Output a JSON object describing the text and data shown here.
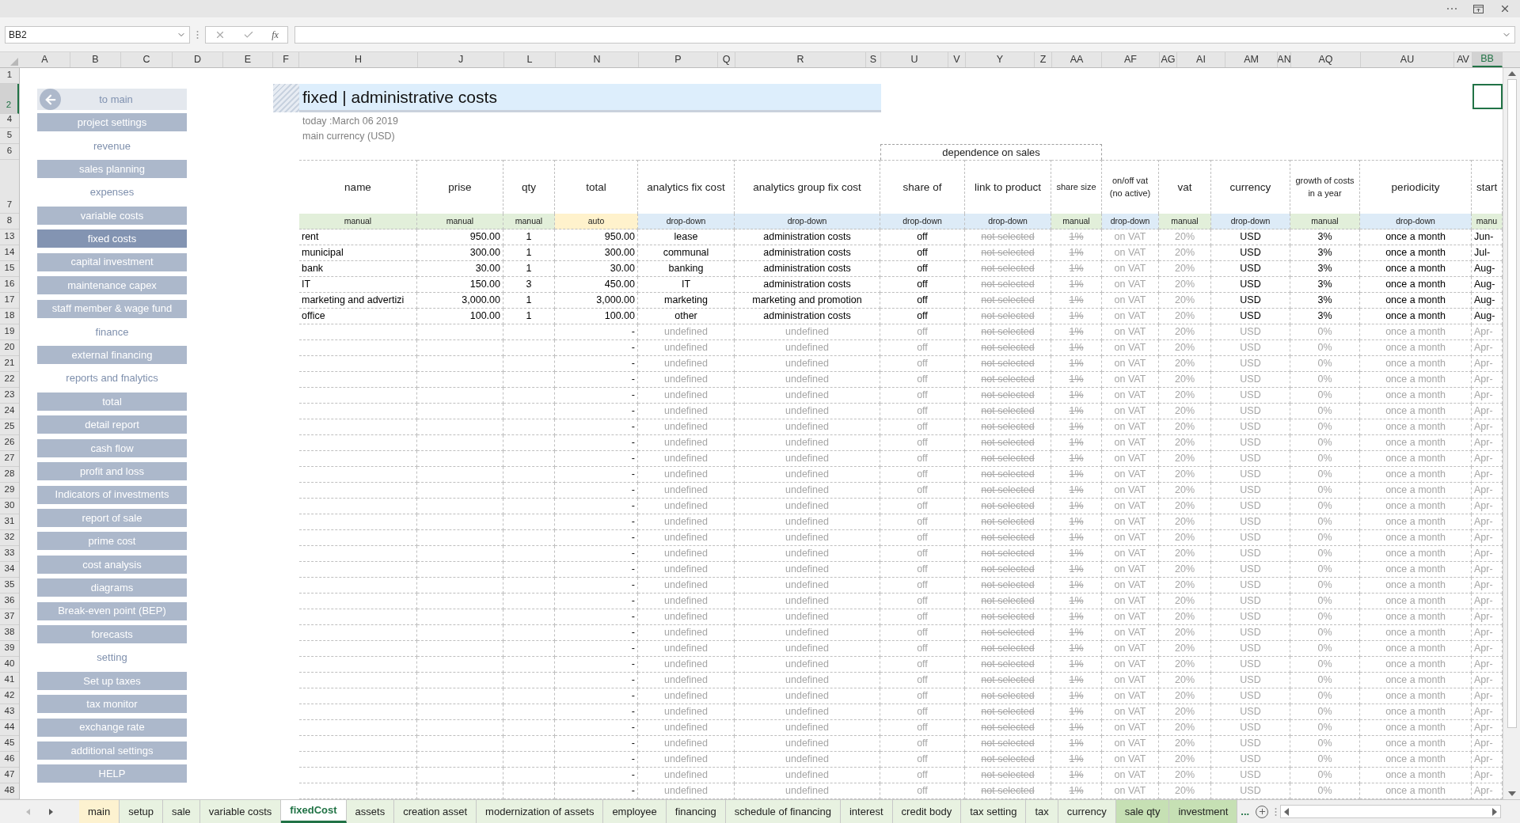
{
  "name_box": {
    "value": "BB2"
  },
  "formula_bar": {
    "function_label": "fx"
  },
  "column_headers": [
    {
      "label": "A",
      "selected": false
    },
    {
      "label": "B",
      "selected": false
    },
    {
      "label": "C",
      "selected": false
    },
    {
      "label": "D",
      "selected": false
    },
    {
      "label": "E",
      "selected": false
    },
    {
      "label": "F",
      "selected": false
    },
    {
      "label": "H",
      "selected": false
    },
    {
      "label": "J",
      "selected": false
    },
    {
      "label": "L",
      "selected": false
    },
    {
      "label": "N",
      "selected": false
    },
    {
      "label": "P",
      "selected": false
    },
    {
      "label": "Q",
      "selected": false
    },
    {
      "label": "R",
      "selected": false
    },
    {
      "label": "S",
      "selected": false
    },
    {
      "label": "U",
      "selected": false
    },
    {
      "label": "V",
      "selected": false
    },
    {
      "label": "Y",
      "selected": false
    },
    {
      "label": "Z",
      "selected": false
    },
    {
      "label": "AA",
      "selected": false
    },
    {
      "label": "AF",
      "selected": false
    },
    {
      "label": "AG",
      "selected": false
    },
    {
      "label": "AI",
      "selected": false
    },
    {
      "label": "AM",
      "selected": false
    },
    {
      "label": "AN",
      "selected": false
    },
    {
      "label": "AQ",
      "selected": false
    },
    {
      "label": "AU",
      "selected": false
    },
    {
      "label": "AV",
      "selected": false
    },
    {
      "label": "BB",
      "selected": true
    }
  ],
  "row_numbers": [
    {
      "label": "1",
      "selected": false
    },
    {
      "label": "2",
      "selected": true
    },
    {
      "label": "4",
      "selected": false
    },
    {
      "label": "5",
      "selected": false
    },
    {
      "label": "6",
      "selected": false
    },
    {
      "label": "7",
      "selected": false
    },
    {
      "label": "8",
      "selected": false
    },
    {
      "label": "13",
      "selected": false
    },
    {
      "label": "14",
      "selected": false
    },
    {
      "label": "15",
      "selected": false
    },
    {
      "label": "16",
      "selected": false
    },
    {
      "label": "17",
      "selected": false
    },
    {
      "label": "18",
      "selected": false
    },
    {
      "label": "19",
      "selected": false
    },
    {
      "label": "20",
      "selected": false
    },
    {
      "label": "21",
      "selected": false
    },
    {
      "label": "22",
      "selected": false
    },
    {
      "label": "23",
      "selected": false
    },
    {
      "label": "24",
      "selected": false
    },
    {
      "label": "25",
      "selected": false
    },
    {
      "label": "26",
      "selected": false
    },
    {
      "label": "27",
      "selected": false
    },
    {
      "label": "28",
      "selected": false
    },
    {
      "label": "29",
      "selected": false
    },
    {
      "label": "30",
      "selected": false
    },
    {
      "label": "31",
      "selected": false
    },
    {
      "label": "32",
      "selected": false
    },
    {
      "label": "33",
      "selected": false
    },
    {
      "label": "34",
      "selected": false
    },
    {
      "label": "35",
      "selected": false
    },
    {
      "label": "36",
      "selected": false
    },
    {
      "label": "37",
      "selected": false
    },
    {
      "label": "38",
      "selected": false
    },
    {
      "label": "39",
      "selected": false
    },
    {
      "label": "40",
      "selected": false
    },
    {
      "label": "41",
      "selected": false
    },
    {
      "label": "42",
      "selected": false
    },
    {
      "label": "43",
      "selected": false
    },
    {
      "label": "44",
      "selected": false
    },
    {
      "label": "45",
      "selected": false
    },
    {
      "label": "46",
      "selected": false
    },
    {
      "label": "47",
      "selected": false
    },
    {
      "label": "48",
      "selected": false
    }
  ],
  "sidebar": [
    {
      "kind": "back",
      "label": "to main"
    },
    {
      "kind": "button",
      "label": "project settings",
      "selected": false
    },
    {
      "kind": "section",
      "label": "revenue"
    },
    {
      "kind": "button",
      "label": "sales planning",
      "selected": false
    },
    {
      "kind": "section",
      "label": "expenses"
    },
    {
      "kind": "button",
      "label": "variable costs",
      "selected": false
    },
    {
      "kind": "button",
      "label": "fixed costs",
      "selected": true
    },
    {
      "kind": "button",
      "label": "capital investment",
      "selected": false
    },
    {
      "kind": "button",
      "label": "maintenance capex",
      "selected": false
    },
    {
      "kind": "button",
      "label": "staff member & wage fund",
      "selected": false
    },
    {
      "kind": "section",
      "label": "finance"
    },
    {
      "kind": "button",
      "label": "external financing",
      "selected": false
    },
    {
      "kind": "section",
      "label": "reports and fnalytics"
    },
    {
      "kind": "button",
      "label": "total",
      "selected": false
    },
    {
      "kind": "button",
      "label": "detail report",
      "selected": false
    },
    {
      "kind": "button",
      "label": "cash flow",
      "selected": false
    },
    {
      "kind": "button",
      "label": "profit and loss",
      "selected": false
    },
    {
      "kind": "button",
      "label": "Indicators of investments",
      "selected": false
    },
    {
      "kind": "button",
      "label": "report of sale",
      "selected": false
    },
    {
      "kind": "button",
      "label": "prime cost",
      "selected": false
    },
    {
      "kind": "button",
      "label": "cost analysis",
      "selected": false
    },
    {
      "kind": "button",
      "label": "diagrams",
      "selected": false
    },
    {
      "kind": "button",
      "label": "Break-even point (BEP)",
      "selected": false
    },
    {
      "kind": "button",
      "label": "forecasts",
      "selected": false
    },
    {
      "kind": "section",
      "label": "setting"
    },
    {
      "kind": "button",
      "label": "Set up taxes",
      "selected": false
    },
    {
      "kind": "button",
      "label": "tax monitor",
      "selected": false
    },
    {
      "kind": "button",
      "label": "exchange rate",
      "selected": false
    },
    {
      "kind": "button",
      "label": "additional settings",
      "selected": false
    },
    {
      "kind": "button",
      "label": "HELP",
      "selected": false
    }
  ],
  "sheet": {
    "title": "fixed | administrative costs",
    "today": "today :March 06 2019",
    "currency": "main currency (USD)",
    "group_header": "dependence on sales",
    "columns": [
      {
        "label": "name",
        "input": "manual"
      },
      {
        "label": "prise",
        "input": "manual"
      },
      {
        "label": "qty",
        "input": "manual"
      },
      {
        "label": "total",
        "input": "auto"
      },
      {
        "label": "analytics fix cost",
        "input": "drop-down"
      },
      {
        "label": "analytics group fix cost",
        "input": "drop-down"
      },
      {
        "label": "share of",
        "input": "drop-down"
      },
      {
        "label": "link to product",
        "input": "drop-down"
      },
      {
        "label": "share size",
        "input": "manual"
      },
      {
        "label": "on/off vat (no active)",
        "input": "drop-down"
      },
      {
        "label": "vat",
        "input": "manual"
      },
      {
        "label": "currency",
        "input": "drop-down"
      },
      {
        "label": "growth of costs in a year",
        "input": "manual"
      },
      {
        "label": "periodicity",
        "input": "drop-down"
      },
      {
        "label": "start",
        "input": "manu"
      }
    ],
    "rows": [
      {
        "defined": true,
        "cells": [
          "rent",
          "950.00",
          "1",
          "950.00",
          "lease",
          "administration costs",
          "off",
          "not selected",
          "1%",
          "on VAT",
          "20%",
          "USD",
          "3%",
          "once a month",
          "Jun-"
        ]
      },
      {
        "defined": true,
        "cells": [
          "municipal",
          "300.00",
          "1",
          "300.00",
          "communal",
          "administration costs",
          "off",
          "not selected",
          "1%",
          "on VAT",
          "20%",
          "USD",
          "3%",
          "once a month",
          "Jul-"
        ]
      },
      {
        "defined": true,
        "cells": [
          "bank",
          "30.00",
          "1",
          "30.00",
          "banking",
          "administration costs",
          "off",
          "not selected",
          "1%",
          "on VAT",
          "20%",
          "USD",
          "3%",
          "once a month",
          "Aug-"
        ]
      },
      {
        "defined": true,
        "cells": [
          "IT",
          "150.00",
          "3",
          "450.00",
          "IT",
          "administration costs",
          "off",
          "not selected",
          "1%",
          "on VAT",
          "20%",
          "USD",
          "3%",
          "once a month",
          "Aug-"
        ]
      },
      {
        "defined": true,
        "cells": [
          "marketing and advertizi",
          "3,000.00",
          "1",
          "3,000.00",
          "marketing",
          "marketing and promotion",
          "off",
          "not selected",
          "1%",
          "on VAT",
          "20%",
          "USD",
          "3%",
          "once a month",
          "Aug-"
        ]
      },
      {
        "defined": true,
        "cells": [
          "office",
          "100.00",
          "1",
          "100.00",
          "other",
          "administration costs",
          "off",
          "not selected",
          "1%",
          "on VAT",
          "20%",
          "USD",
          "3%",
          "once a month",
          "Aug-"
        ]
      },
      {
        "defined": false,
        "cells": [
          "-",
          "undefined",
          "undefined",
          "off",
          "not selected",
          "1%",
          "on VAT",
          "20%",
          "USD",
          "0%",
          "once a month",
          "Apr-"
        ]
      },
      {
        "defined": false,
        "cells": [
          "-",
          "undefined",
          "undefined",
          "off",
          "not selected",
          "1%",
          "on VAT",
          "20%",
          "USD",
          "0%",
          "once a month",
          "Apr-"
        ]
      },
      {
        "defined": false,
        "cells": [
          "-",
          "undefined",
          "undefined",
          "off",
          "not selected",
          "1%",
          "on VAT",
          "20%",
          "USD",
          "0%",
          "once a month",
          "Apr-"
        ]
      },
      {
        "defined": false,
        "cells": [
          "-",
          "undefined",
          "undefined",
          "off",
          "not selected",
          "1%",
          "on VAT",
          "20%",
          "USD",
          "0%",
          "once a month",
          "Apr-"
        ]
      },
      {
        "defined": false,
        "cells": [
          "-",
          "undefined",
          "undefined",
          "off",
          "not selected",
          "1%",
          "on VAT",
          "20%",
          "USD",
          "0%",
          "once a month",
          "Apr-"
        ]
      },
      {
        "defined": false,
        "cells": [
          "-",
          "undefined",
          "undefined",
          "off",
          "not selected",
          "1%",
          "on VAT",
          "20%",
          "USD",
          "0%",
          "once a month",
          "Apr-"
        ]
      },
      {
        "defined": false,
        "cells": [
          "-",
          "undefined",
          "undefined",
          "off",
          "not selected",
          "1%",
          "on VAT",
          "20%",
          "USD",
          "0%",
          "once a month",
          "Apr-"
        ]
      },
      {
        "defined": false,
        "cells": [
          "-",
          "undefined",
          "undefined",
          "off",
          "not selected",
          "1%",
          "on VAT",
          "20%",
          "USD",
          "0%",
          "once a month",
          "Apr-"
        ]
      },
      {
        "defined": false,
        "cells": [
          "-",
          "undefined",
          "undefined",
          "off",
          "not selected",
          "1%",
          "on VAT",
          "20%",
          "USD",
          "0%",
          "once a month",
          "Apr-"
        ]
      },
      {
        "defined": false,
        "cells": [
          "-",
          "undefined",
          "undefined",
          "off",
          "not selected",
          "1%",
          "on VAT",
          "20%",
          "USD",
          "0%",
          "once a month",
          "Apr-"
        ]
      },
      {
        "defined": false,
        "cells": [
          "-",
          "undefined",
          "undefined",
          "off",
          "not selected",
          "1%",
          "on VAT",
          "20%",
          "USD",
          "0%",
          "once a month",
          "Apr-"
        ]
      },
      {
        "defined": false,
        "cells": [
          "-",
          "undefined",
          "undefined",
          "off",
          "not selected",
          "1%",
          "on VAT",
          "20%",
          "USD",
          "0%",
          "once a month",
          "Apr-"
        ]
      },
      {
        "defined": false,
        "cells": [
          "-",
          "undefined",
          "undefined",
          "off",
          "not selected",
          "1%",
          "on VAT",
          "20%",
          "USD",
          "0%",
          "once a month",
          "Apr-"
        ]
      },
      {
        "defined": false,
        "cells": [
          "-",
          "undefined",
          "undefined",
          "off",
          "not selected",
          "1%",
          "on VAT",
          "20%",
          "USD",
          "0%",
          "once a month",
          "Apr-"
        ]
      },
      {
        "defined": false,
        "cells": [
          "-",
          "undefined",
          "undefined",
          "off",
          "not selected",
          "1%",
          "on VAT",
          "20%",
          "USD",
          "0%",
          "once a month",
          "Apr-"
        ]
      },
      {
        "defined": false,
        "cells": [
          "-",
          "undefined",
          "undefined",
          "off",
          "not selected",
          "1%",
          "on VAT",
          "20%",
          "USD",
          "0%",
          "once a month",
          "Apr-"
        ]
      },
      {
        "defined": false,
        "cells": [
          "-",
          "undefined",
          "undefined",
          "off",
          "not selected",
          "1%",
          "on VAT",
          "20%",
          "USD",
          "0%",
          "once a month",
          "Apr-"
        ]
      },
      {
        "defined": false,
        "cells": [
          "-",
          "undefined",
          "undefined",
          "off",
          "not selected",
          "1%",
          "on VAT",
          "20%",
          "USD",
          "0%",
          "once a month",
          "Apr-"
        ]
      },
      {
        "defined": false,
        "cells": [
          "-",
          "undefined",
          "undefined",
          "off",
          "not selected",
          "1%",
          "on VAT",
          "20%",
          "USD",
          "0%",
          "once a month",
          "Apr-"
        ]
      },
      {
        "defined": false,
        "cells": [
          "-",
          "undefined",
          "undefined",
          "off",
          "not selected",
          "1%",
          "on VAT",
          "20%",
          "USD",
          "0%",
          "once a month",
          "Apr-"
        ]
      },
      {
        "defined": false,
        "cells": [
          "-",
          "undefined",
          "undefined",
          "off",
          "not selected",
          "1%",
          "on VAT",
          "20%",
          "USD",
          "0%",
          "once a month",
          "Apr-"
        ]
      },
      {
        "defined": false,
        "cells": [
          "-",
          "undefined",
          "undefined",
          "off",
          "not selected",
          "1%",
          "on VAT",
          "20%",
          "USD",
          "0%",
          "once a month",
          "Apr-"
        ]
      },
      {
        "defined": false,
        "cells": [
          "-",
          "undefined",
          "undefined",
          "off",
          "not selected",
          "1%",
          "on VAT",
          "20%",
          "USD",
          "0%",
          "once a month",
          "Apr-"
        ]
      },
      {
        "defined": false,
        "cells": [
          "-",
          "undefined",
          "undefined",
          "off",
          "not selected",
          "1%",
          "on VAT",
          "20%",
          "USD",
          "0%",
          "once a month",
          "Apr-"
        ]
      },
      {
        "defined": false,
        "cells": [
          "-",
          "undefined",
          "undefined",
          "off",
          "not selected",
          "1%",
          "on VAT",
          "20%",
          "USD",
          "0%",
          "once a month",
          "Apr-"
        ]
      },
      {
        "defined": false,
        "cells": [
          "-",
          "undefined",
          "undefined",
          "off",
          "not selected",
          "1%",
          "on VAT",
          "20%",
          "USD",
          "0%",
          "once a month",
          "Apr-"
        ]
      },
      {
        "defined": false,
        "cells": [
          "-",
          "undefined",
          "undefined",
          "off",
          "not selected",
          "1%",
          "on VAT",
          "20%",
          "USD",
          "0%",
          "once a month",
          "Apr-"
        ]
      },
      {
        "defined": false,
        "cells": [
          "-",
          "undefined",
          "undefined",
          "off",
          "not selected",
          "1%",
          "on VAT",
          "20%",
          "USD",
          "0%",
          "once a month",
          "Apr-"
        ]
      },
      {
        "defined": false,
        "cells": [
          "-",
          "undefined",
          "undefined",
          "off",
          "not selected",
          "1%",
          "on VAT",
          "20%",
          "USD",
          "0%",
          "once a month",
          "Apr-"
        ]
      },
      {
        "defined": false,
        "cells": [
          "-",
          "undefined",
          "undefined",
          "off",
          "not selected",
          "1%",
          "on VAT",
          "20%",
          "USD",
          "0%",
          "once a month",
          "Apr-"
        ]
      }
    ]
  },
  "tabs": [
    {
      "label": "main",
      "selected": false,
      "color": "#fdf2d0"
    },
    {
      "label": "setup",
      "selected": false,
      "color": "#e8f2e1"
    },
    {
      "label": "sale",
      "selected": false,
      "color": "#e8f2e1"
    },
    {
      "label": "variable costs",
      "selected": false,
      "color": "#e8f2e1"
    },
    {
      "label": "fixedCost",
      "selected": true,
      "color": "#ffffff"
    },
    {
      "label": "assets",
      "selected": false,
      "color": "#e8f2e1"
    },
    {
      "label": "creation asset",
      "selected": false,
      "color": "#e8f2e1"
    },
    {
      "label": "modernization of assets",
      "selected": false,
      "color": "#e8f2e1"
    },
    {
      "label": "employee",
      "selected": false,
      "color": "#e8f2e1"
    },
    {
      "label": "financing",
      "selected": false,
      "color": "#e8f2e1"
    },
    {
      "label": "schedule of financing",
      "selected": false,
      "color": "#e8f2e1"
    },
    {
      "label": "interest",
      "selected": false,
      "color": "#e8f2e1"
    },
    {
      "label": "credit body",
      "selected": false,
      "color": "#e8f2e1"
    },
    {
      "label": "tax setting",
      "selected": false,
      "color": "#e8f2e1"
    },
    {
      "label": "tax",
      "selected": false,
      "color": "#e8f2e1"
    },
    {
      "label": "currency",
      "selected": false,
      "color": "#e8f2e1"
    },
    {
      "label": "sale qty",
      "selected": false,
      "color": "#c6e0b4"
    },
    {
      "label": "investment",
      "selected": false,
      "color": "#c6e0b4"
    }
  ],
  "tabs_more": "..."
}
